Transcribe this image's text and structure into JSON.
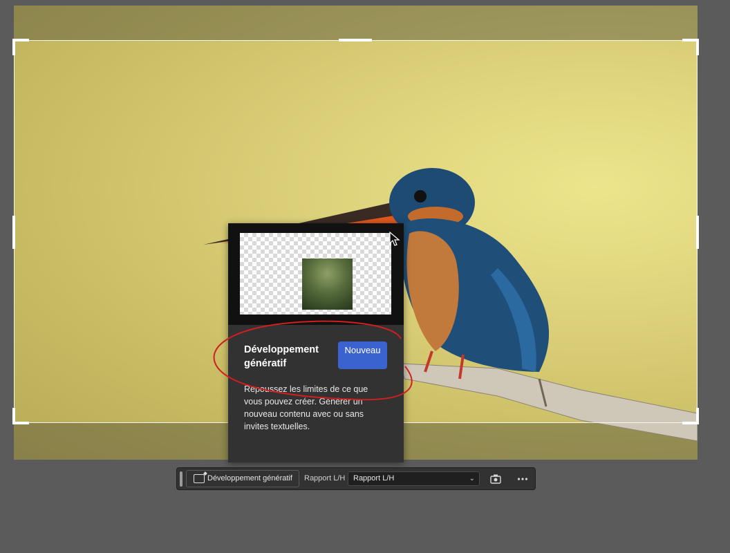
{
  "popup": {
    "title": "Développement génératif",
    "badge": "Nouveau",
    "description": "Repoussez les limites de ce que vous pouvez créer. Générer un nouveau contenu avec ou sans invites textuelles."
  },
  "toolbar": {
    "generative_button_label": "Développement génératif",
    "ratio_label": "Rapport L/H",
    "ratio_select_value": "Rapport L/H"
  },
  "colors": {
    "badge": "#3b63cf",
    "annotation": "#d01f1f",
    "app_background": "#5b5b5b",
    "toolbar": "#323232"
  },
  "icons": [
    "generative-expand-icon",
    "chevron-down-icon",
    "camera-icon",
    "more-icon",
    "cursor-icon"
  ]
}
